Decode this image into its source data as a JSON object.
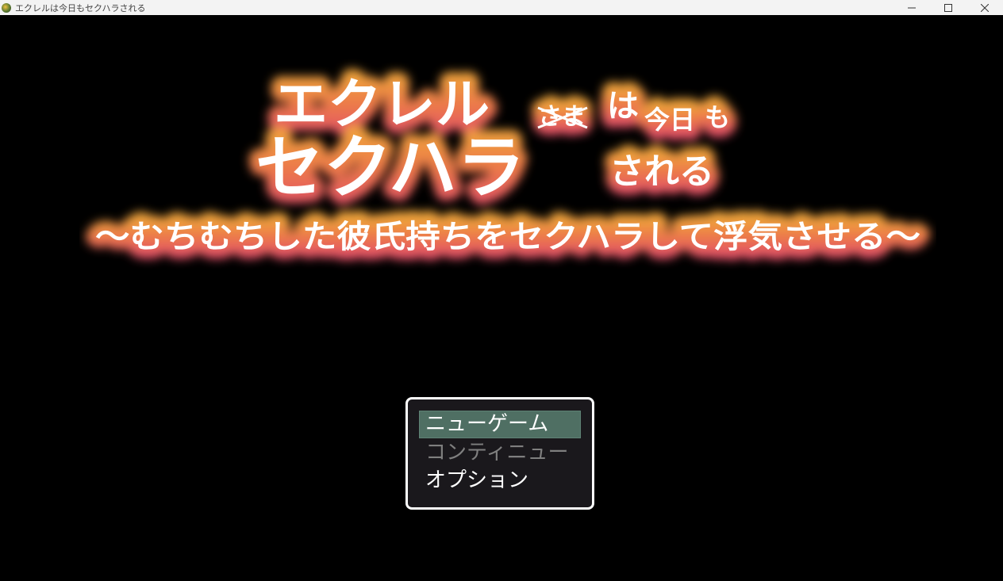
{
  "window": {
    "title": "エクレルは今日もセクハラされる",
    "controls": {
      "minimize": "–",
      "maximize": "☐",
      "close": "✕"
    }
  },
  "logo": {
    "line1_main": "エクレル",
    "line1_struck": "さま",
    "line1_tail_ha": "は",
    "line1_tail_kyou": "今日",
    "line1_tail_mo": "も",
    "line2_main": "セクハラ",
    "line2_tail": "される",
    "subtitle": "～むちむちした彼氏持ちをセクハラして浮気させる～",
    "colors": {
      "gradient_top": "#f0a53a",
      "gradient_mid": "#ec7a4a",
      "gradient_bottom": "#e25068",
      "text": "#ffffff"
    }
  },
  "menu": {
    "items": [
      {
        "label": "ニューゲーム",
        "state": "selected"
      },
      {
        "label": "コンティニュー",
        "state": "disabled"
      },
      {
        "label": "オプション",
        "state": "enabled"
      }
    ],
    "colors": {
      "highlight": "#4f6f63",
      "disabled_text": "#7f7f7f",
      "border": "#ffffff"
    }
  }
}
